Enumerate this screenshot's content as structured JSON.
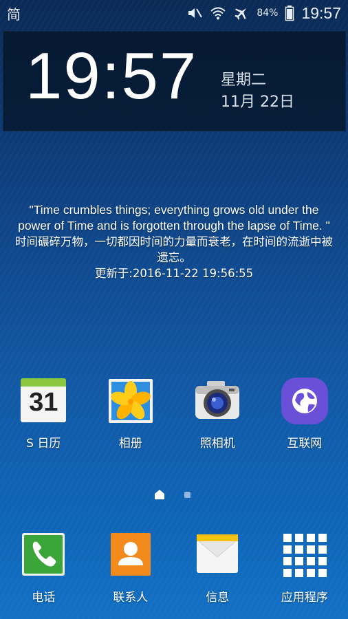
{
  "status_bar": {
    "input_method": "简",
    "battery_percent": "84%",
    "time": "19:57",
    "icons": [
      "mute-icon",
      "wifi-icon",
      "airplane-mode-icon",
      "battery-icon"
    ]
  },
  "clock_widget": {
    "time": "19:57",
    "weekday": "星期二",
    "date": "11月 22日"
  },
  "quote_widget": {
    "english": "\"Time crumbles things; everything grows old under the power of Time and is forgotten through the lapse of Time. \"",
    "chinese": "时间碾碎万物，一切都因时间的力量而衰老，在时间的流逝中被遗忘。",
    "updated": "更新于:2016-11-22 19:56:55"
  },
  "apps_row1": [
    {
      "label": "S 日历",
      "icon": "calendar-icon",
      "badge": "31"
    },
    {
      "label": "相册",
      "icon": "gallery-icon"
    },
    {
      "label": "照相机",
      "icon": "camera-icon"
    },
    {
      "label": "互联网",
      "icon": "internet-icon"
    }
  ],
  "pager": {
    "pages": 2,
    "current": 1
  },
  "dock": [
    {
      "label": "电话",
      "icon": "phone-icon"
    },
    {
      "label": "联系人",
      "icon": "contacts-icon"
    },
    {
      "label": "信息",
      "icon": "messages-icon"
    },
    {
      "label": "应用程序",
      "icon": "apps-grid-icon"
    }
  ],
  "colors": {
    "calendar_green": "#8cc63f",
    "phone_green": "#3aa63a",
    "contacts_orange": "#f28a1c",
    "messages_yellow": "#f5c20f",
    "internet_purple": "#6a4fd8"
  }
}
